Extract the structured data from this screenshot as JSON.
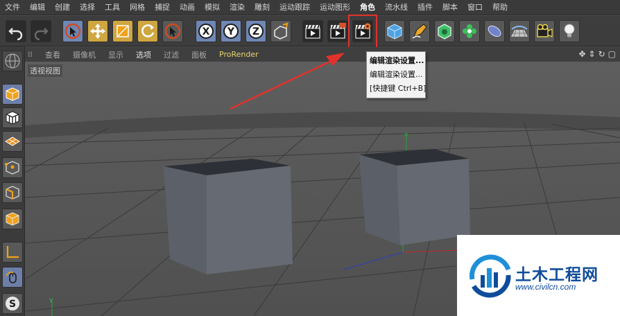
{
  "menubar": {
    "items": [
      {
        "label": "文件"
      },
      {
        "label": "编辑"
      },
      {
        "label": "创建"
      },
      {
        "label": "选择"
      },
      {
        "label": "工具"
      },
      {
        "label": "网格"
      },
      {
        "label": "捕捉"
      },
      {
        "label": "动画"
      },
      {
        "label": "模拟"
      },
      {
        "label": "渲染"
      },
      {
        "label": "雕刻"
      },
      {
        "label": "运动跟踪"
      },
      {
        "label": "运动图形"
      },
      {
        "label": "角色"
      },
      {
        "label": "流水线"
      },
      {
        "label": "插件"
      },
      {
        "label": "脚本"
      },
      {
        "label": "窗口"
      },
      {
        "label": "帮助"
      }
    ]
  },
  "viewport": {
    "menu": [
      {
        "label": "查看"
      },
      {
        "label": "摄像机"
      },
      {
        "label": "显示"
      },
      {
        "label": "选项"
      },
      {
        "label": "过滤"
      },
      {
        "label": "面板"
      },
      {
        "label": "ProRender"
      }
    ],
    "label": "透视视图",
    "nav_icons": [
      "move-icon",
      "zoom-icon",
      "rotate-icon",
      "maximize-icon"
    ]
  },
  "tooltip": {
    "title": "编辑渲染设置...",
    "description": "编辑渲染设置...",
    "shortcut": "[快捷键 Ctrl+B]"
  },
  "axis": {
    "y_label": "Y"
  },
  "watermark": {
    "title": "土木工程网",
    "url": "www.civilcn.com"
  },
  "colors": {
    "highlight_red": "#e2322c",
    "accent_gold": "#cfa640",
    "prorender_yellow": "#e8d56f",
    "watermark_blue": "#0f4c9a"
  }
}
